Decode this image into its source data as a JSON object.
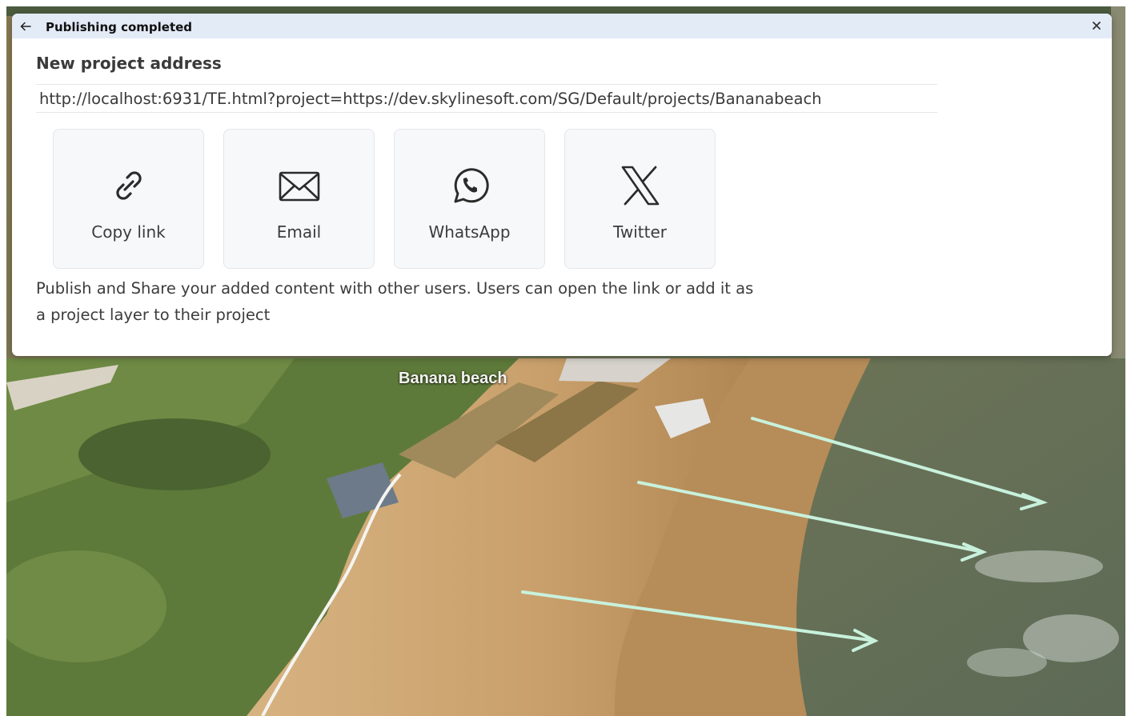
{
  "map": {
    "label": "Banana beach",
    "colors": {
      "vegetation": "#5f7a3c",
      "sand": "#cfa978",
      "wet_sand": "#b38a56",
      "sea": "#6e7a5a",
      "route": "#c8f1dc"
    }
  },
  "dialog": {
    "back_icon": "arrow-left-icon",
    "title": "Publishing completed",
    "close_icon": "close-icon",
    "section_title": "New project address",
    "url_value": "http://localhost:6931/TE.html?project=https://dev.skylinesoft.com/SG/Default/projects/Bananabeach",
    "share_buttons": [
      {
        "label": "Copy link",
        "icon": "link-icon"
      },
      {
        "label": "Email",
        "icon": "envelope-icon"
      },
      {
        "label": "WhatsApp",
        "icon": "whatsapp-icon"
      },
      {
        "label": "Twitter",
        "icon": "x-logo-icon"
      }
    ],
    "description": "Publish and Share your added content with other users. Users can open the link or add it as a project layer to their project",
    "colors": {
      "titlebar": "#e3ebf7",
      "card": "#f7f8fa",
      "text": "#3c3c3c"
    }
  }
}
